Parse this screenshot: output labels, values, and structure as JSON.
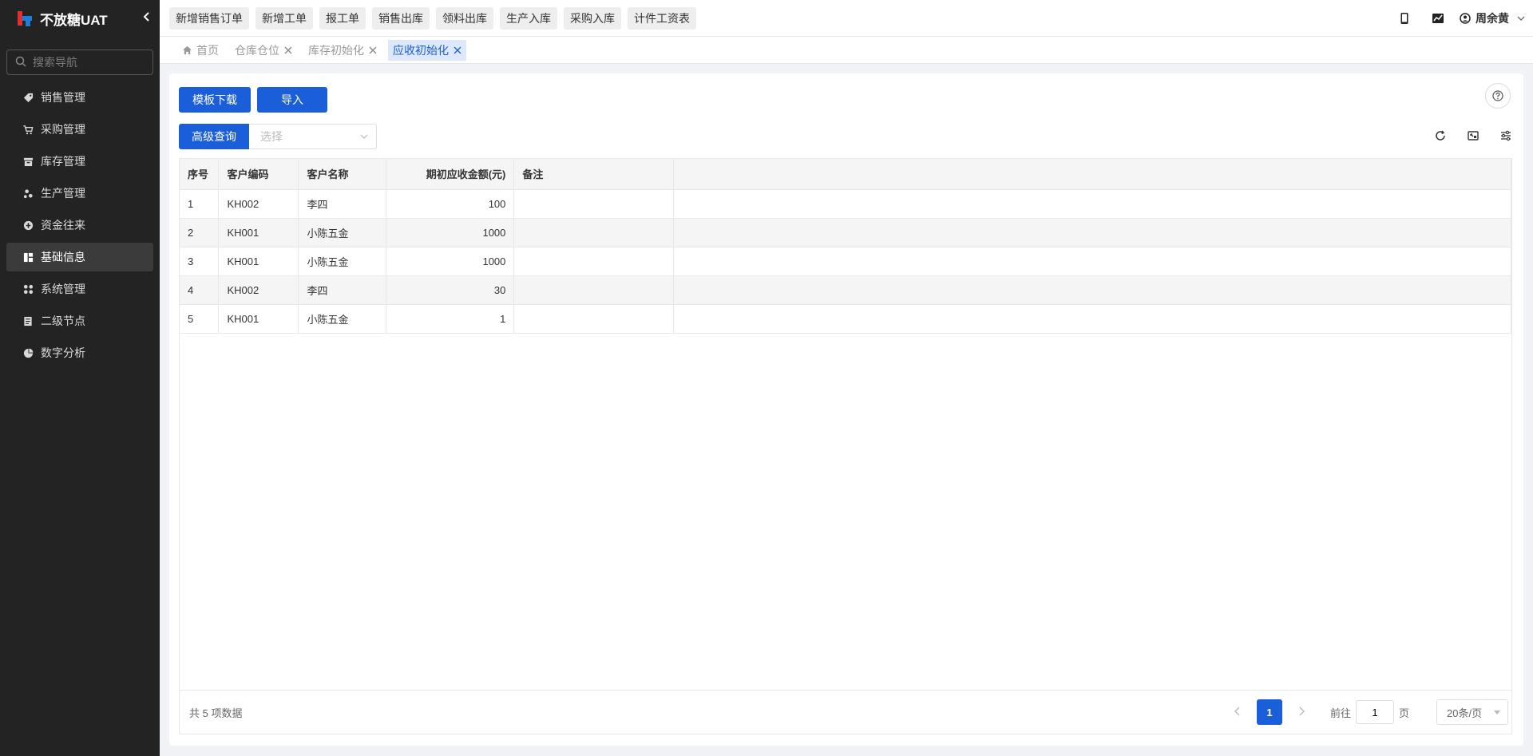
{
  "app": {
    "title": "不放糖UAT"
  },
  "sidebar": {
    "search_placeholder": "搜索导航",
    "items": [
      {
        "label": "销售管理",
        "icon": "tag-icon",
        "active": false
      },
      {
        "label": "采购管理",
        "icon": "cart-icon",
        "active": false
      },
      {
        "label": "库存管理",
        "icon": "inventory-icon",
        "active": false
      },
      {
        "label": "生产管理",
        "icon": "production-icon",
        "active": false
      },
      {
        "label": "资金往来",
        "icon": "funds-icon",
        "active": false
      },
      {
        "label": "基础信息",
        "icon": "basic-info-icon",
        "active": true
      },
      {
        "label": "系统管理",
        "icon": "apps-icon",
        "active": false
      },
      {
        "label": "二级节点",
        "icon": "document-icon",
        "active": false
      },
      {
        "label": "数字分析",
        "icon": "pie-chart-icon",
        "active": false
      }
    ]
  },
  "topbar": {
    "quick_buttons": [
      "新增销售订单",
      "新增工单",
      "报工单",
      "销售出库",
      "领料出库",
      "生产入库",
      "采购入库",
      "计件工资表"
    ],
    "user_name": "周余黄"
  },
  "tabs": [
    {
      "label": "首页",
      "closable": false,
      "active": false
    },
    {
      "label": "仓库仓位",
      "closable": true,
      "active": false
    },
    {
      "label": "库存初始化",
      "closable": true,
      "active": false
    },
    {
      "label": "应收初始化",
      "closable": true,
      "active": true
    }
  ],
  "toolbar": {
    "template_download": "模板下载",
    "import": "导入",
    "advanced_query": "高级查询",
    "select_placeholder": "选择"
  },
  "table": {
    "columns": [
      "序号",
      "客户编码",
      "客户名称",
      "期初应收金额(元)",
      "备注"
    ],
    "rows": [
      [
        "1",
        "KH002",
        "李四",
        "100",
        ""
      ],
      [
        "2",
        "KH001",
        "小陈五金",
        "1000",
        ""
      ],
      [
        "3",
        "KH001",
        "小陈五金",
        "1000",
        ""
      ],
      [
        "4",
        "KH002",
        "李四",
        "30",
        ""
      ],
      [
        "5",
        "KH001",
        "小陈五金",
        "1",
        ""
      ]
    ]
  },
  "pager": {
    "total_text": "共 5 项数据",
    "current_page": "1",
    "goto_prefix": "前往",
    "goto_value": "1",
    "goto_suffix": "页",
    "page_size": "20条/页"
  },
  "colors": {
    "primary": "#1a5fd9",
    "sidebar_bg": "#232323"
  }
}
